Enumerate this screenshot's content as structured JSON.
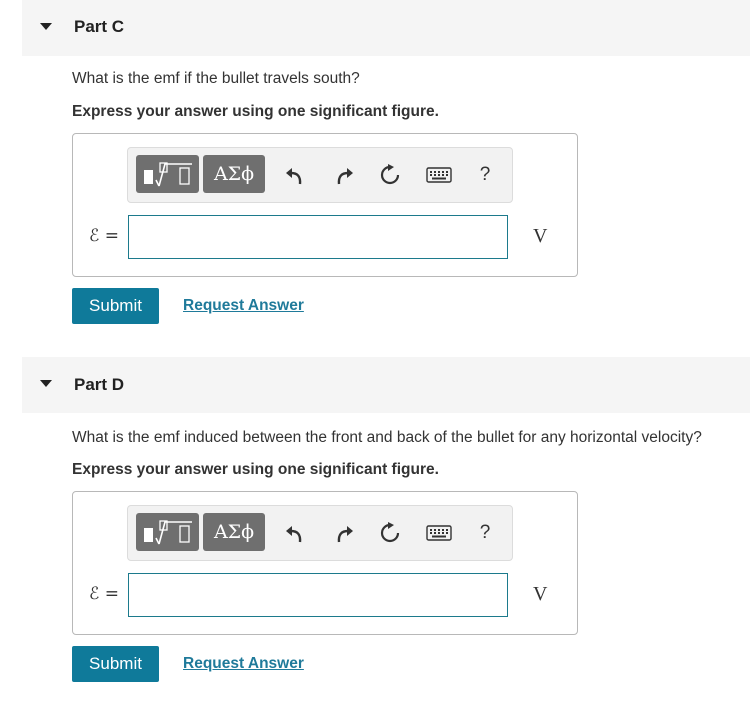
{
  "parts": [
    {
      "title": "Part C",
      "question": "What is the emf if the bullet travels south?",
      "instruction": "Express your answer using one significant figure.",
      "variable_label": "ℰ =",
      "input_value": "",
      "unit": "V",
      "submit_label": "Submit",
      "request_label": "Request Answer",
      "toolbar": {
        "greek_label": "ΑΣϕ",
        "help_label": "?"
      }
    },
    {
      "title": "Part D",
      "question": "What is the emf induced between the front and back of the bullet for any horizontal velocity?",
      "instruction": "Express your answer using one significant figure.",
      "variable_label": "ℰ =",
      "input_value": "",
      "unit": "V",
      "submit_label": "Submit",
      "request_label": "Request Answer",
      "toolbar": {
        "greek_label": "ΑΣϕ",
        "help_label": "?"
      }
    }
  ],
  "colors": {
    "accent": "#0f7a9a",
    "header_bg": "#f5f5f5",
    "toolbar_button": "#6f6f6f"
  },
  "icons": [
    "collapse-caret-icon",
    "templates-icon",
    "undo-icon",
    "redo-icon",
    "reset-icon",
    "keyboard-icon",
    "help-icon"
  ]
}
